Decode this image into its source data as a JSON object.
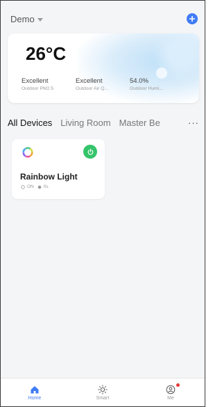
{
  "header": {
    "home_name": "Demo"
  },
  "weather": {
    "temperature": "26°C",
    "metrics": [
      {
        "value": "Excellent",
        "label": "Outdoor PM2.5"
      },
      {
        "value": "Excellent",
        "label": "Outdoor Air Q..."
      },
      {
        "value": "54.0%",
        "label": "Outdoor Humi..."
      }
    ]
  },
  "tabs": [
    "All Devices",
    "Living Room",
    "Master Be"
  ],
  "device": {
    "name": "Rainbow Light",
    "power_state": "ON",
    "status_value": "0s"
  },
  "bottom_nav": [
    {
      "label": "Home",
      "icon": "home-icon"
    },
    {
      "label": "Smart",
      "icon": "sun-icon"
    },
    {
      "label": "Me",
      "icon": "user-icon"
    }
  ],
  "colors": {
    "accent": "#3f7bf6",
    "power_on": "#35c46a",
    "badge": "#e53935"
  }
}
